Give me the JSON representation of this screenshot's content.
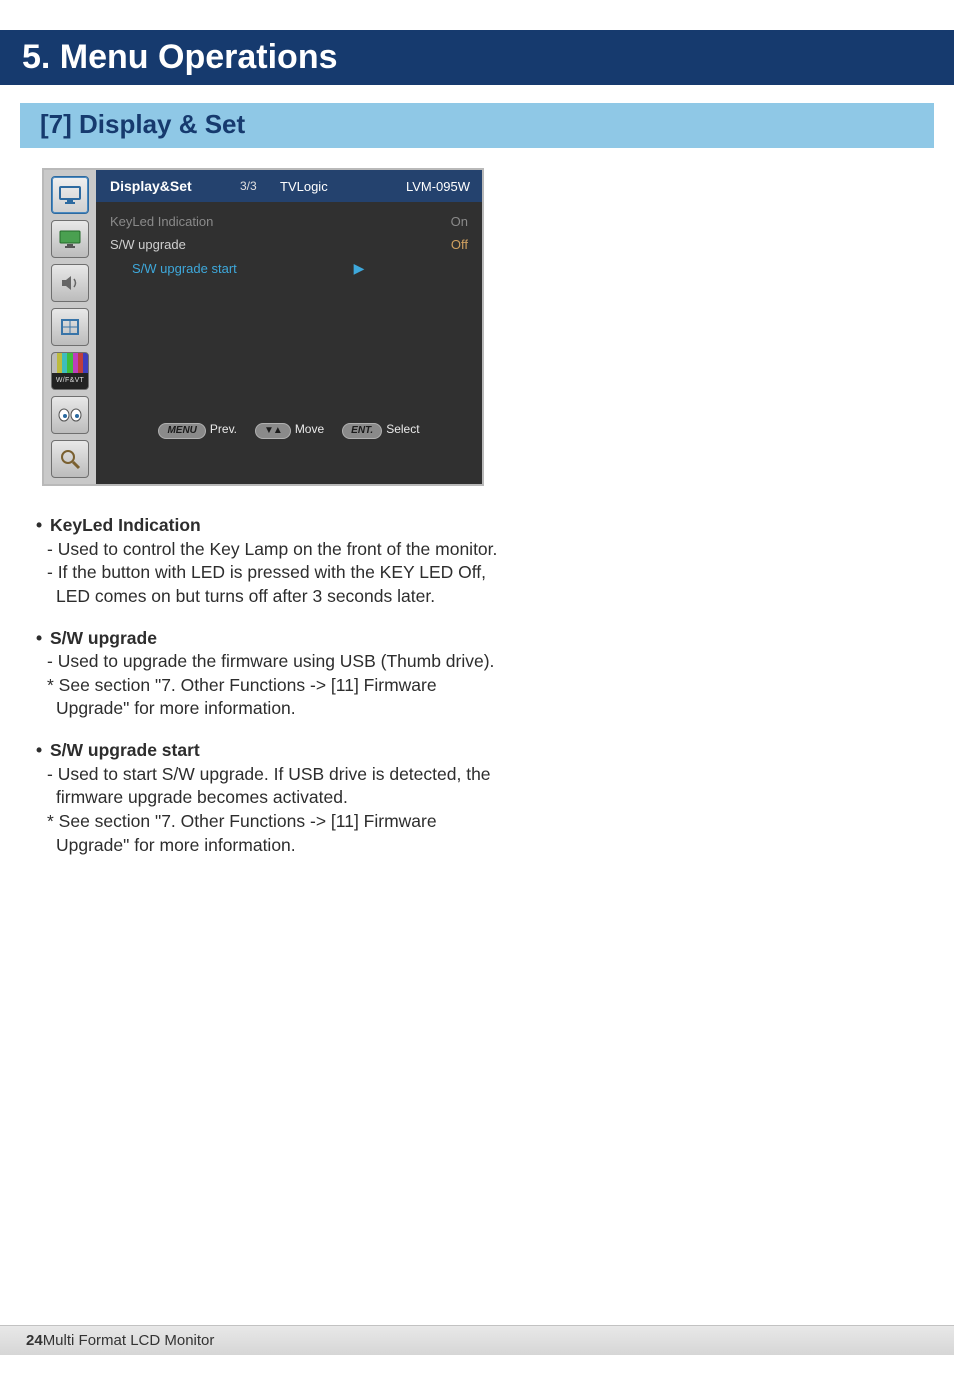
{
  "page_title": "5. Menu Operations",
  "section_title": "[7] Display & Set",
  "osd": {
    "header": {
      "title": "Display&Set",
      "page": "3/3",
      "brand": "TVLogic",
      "model": "LVM-095W"
    },
    "rows": [
      {
        "label": "KeyLed Indication",
        "value": "On",
        "selected": true
      },
      {
        "label": "S/W upgrade",
        "value": "Off"
      },
      {
        "label": "S/W upgrade start",
        "sub": true
      }
    ],
    "footer": {
      "prev": {
        "key": "MENU",
        "label": "Prev."
      },
      "move": {
        "key": "▼▲",
        "label": "Move"
      },
      "select": {
        "key": "ENT.",
        "label": "Select"
      }
    }
  },
  "features": [
    {
      "title": "KeyLed Indication",
      "lines": [
        "- Used to control the Key Lamp on the front of the monitor.",
        "- If the button with LED is pressed with the KEY LED Off, LED comes on but turns off after 3 seconds later."
      ]
    },
    {
      "title": "S/W upgrade",
      "lines": [
        "- Used to upgrade the firmware using USB (Thumb drive).",
        "* See section \"7. Other Functions -> [11] Firmware Upgrade\" for more information."
      ]
    },
    {
      "title": "S/W upgrade start",
      "lines": [
        "- Used to start S/W upgrade. If USB drive is detected, the firmware upgrade becomes activated.",
        "* See section \"7. Other Functions -> [11] Firmware Upgrade\" for more information."
      ]
    }
  ],
  "footer": {
    "page_num": "24",
    "sep": " ",
    "doc_title": "Multi Format LCD Monitor"
  }
}
